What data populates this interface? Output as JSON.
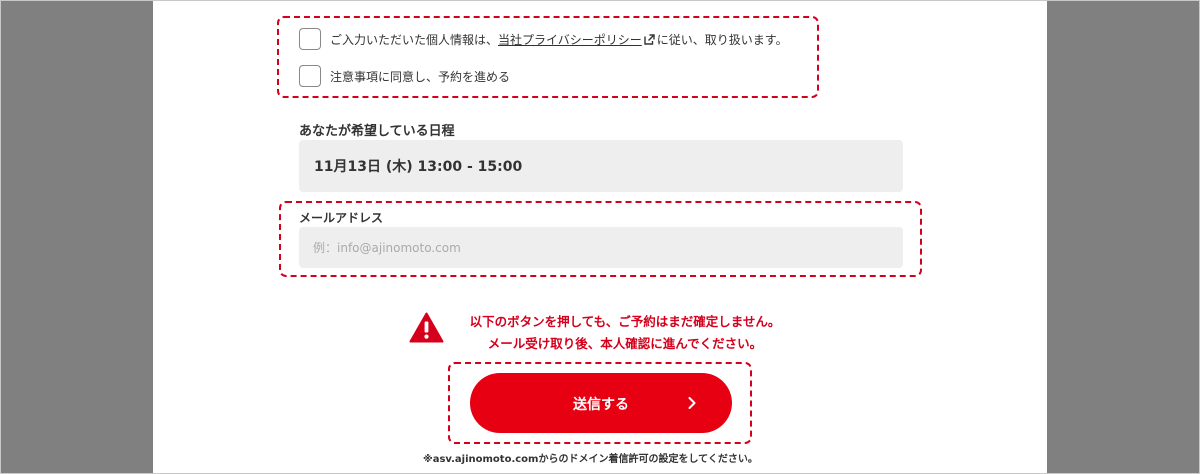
{
  "consent": {
    "privacy_prefix": "ご入力いただいた個人情報は、",
    "privacy_link": "当社プライバシーポリシー",
    "privacy_suffix": "に従い、取り扱います。",
    "terms_label": "注意事項に同意し、予約を進める",
    "privacy_checked": false,
    "terms_checked": false
  },
  "schedule": {
    "label": "あなたが希望している日程",
    "value": "11月13日 (木) 13:00 - 15:00"
  },
  "email": {
    "label": "メールアドレス",
    "placeholder": "例：info@ajinomoto.com",
    "value": ""
  },
  "warning": {
    "icon": "warning-icon",
    "line1": "以下のボタンを押しても、ご予約はまだ確定しません。",
    "line2": "メール受け取り後、本人確認に進んでください。"
  },
  "submit": {
    "label": "送信する",
    "icon": "chevron-right-icon"
  },
  "note": "※asv.ajinomoto.comからのドメイン着信許可の設定をしてください。",
  "colors": {
    "accent": "#e60012",
    "warning_text": "#d4001c",
    "field_background": "#eeeeee",
    "side_background": "#808080"
  }
}
